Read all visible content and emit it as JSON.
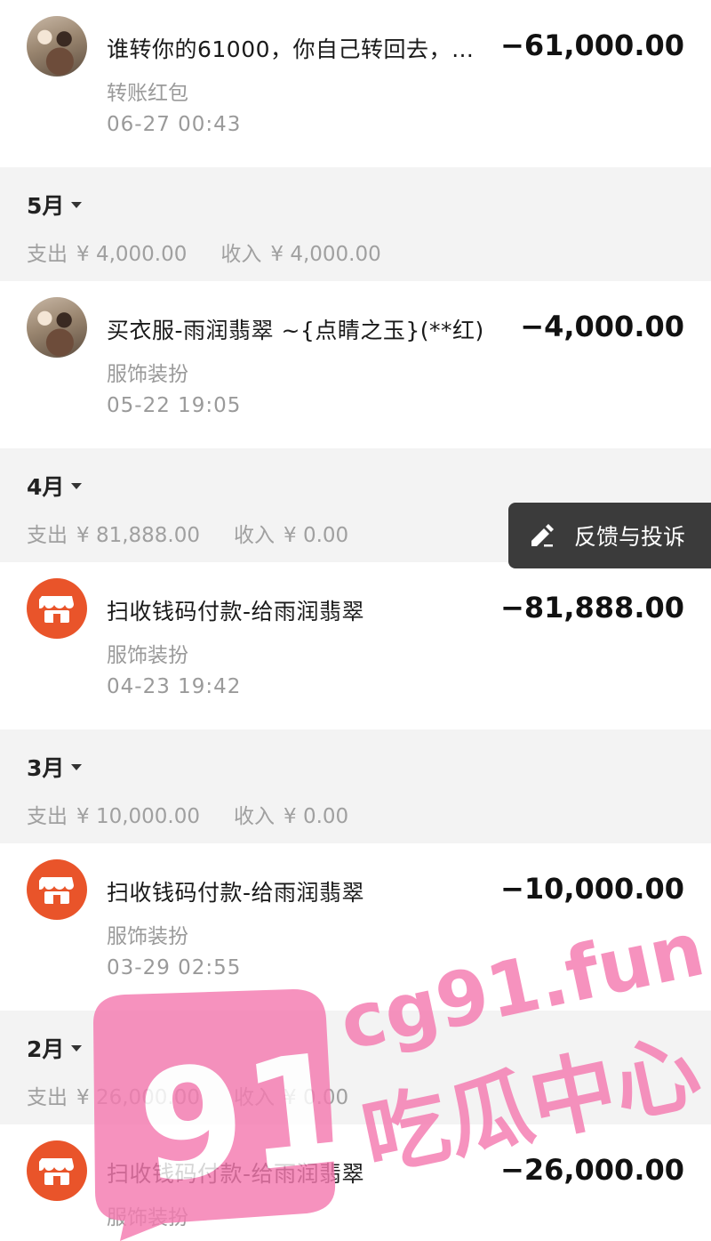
{
  "transactions": [
    {
      "title": "谁转你的61000，你自己转回去，…",
      "category": "转账红包",
      "time": "06-27  00:43",
      "amount": "−61,000.00",
      "avatar": "user-photo"
    },
    {
      "title": "买衣服-雨润翡翠 ~{点睛之玉}(**红)",
      "category": "服饰装扮",
      "time": "05-22  19:05",
      "amount": "−4,000.00",
      "avatar": "user-photo"
    },
    {
      "title": "扫收钱码付款-给雨润翡翠",
      "category": "服饰装扮",
      "time": "04-23  19:42",
      "amount": "−81,888.00",
      "avatar": "shop-icon"
    },
    {
      "title": "扫收钱码付款-给雨润翡翠",
      "category": "服饰装扮",
      "time": "03-29  02:55",
      "amount": "−10,000.00",
      "avatar": "shop-icon"
    },
    {
      "title": "扫收钱码付款-给雨润翡翠",
      "category": "服饰装扮",
      "time": "",
      "amount": "−26,000.00",
      "avatar": "shop-icon"
    }
  ],
  "months": [
    {
      "label": "5月",
      "expense_label": "支出",
      "expense": "¥ 4,000.00",
      "income_label": "收入",
      "income": "¥ 4,000.00"
    },
    {
      "label": "4月",
      "expense_label": "支出",
      "expense": "¥ 81,888.00",
      "income_label": "收入",
      "income": "¥ 0.00"
    },
    {
      "label": "3月",
      "expense_label": "支出",
      "expense": "¥ 10,000.00",
      "income_label": "收入",
      "income": "¥ 0.00"
    },
    {
      "label": "2月",
      "expense_label": "支出",
      "expense": "¥ 26,000.00",
      "income_label": "收入",
      "income": "¥ 0.00"
    }
  ],
  "feedback": {
    "label": "反馈与投诉",
    "icon": "edit-pen-icon"
  },
  "watermark": {
    "logo": "91",
    "site": "cg91.fun",
    "slogan": "吃瓜中心",
    "color": "#f47ab0"
  }
}
